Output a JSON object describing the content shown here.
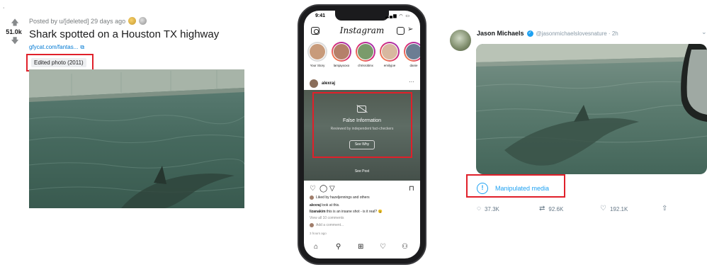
{
  "reddit": {
    "corner_mark": "˙",
    "score": "51.0k",
    "meta": "Posted by u/[deleted] 29 days ago",
    "title": "Shark spotted on a Houston TX highway",
    "link": "gfycat.com/fantas...",
    "flair": "Edited photo (2011)"
  },
  "instagram": {
    "time": "9:41",
    "status_icons": "▂▄▆ ◠ ▭",
    "logo": "Instagram",
    "stories": [
      {
        "name": "Your Story"
      },
      {
        "name": "lamjayxoxo"
      },
      {
        "name": "chrisrobinx"
      },
      {
        "name": "emilyjoe"
      },
      {
        "name": "danie"
      }
    ],
    "post_user": "alexraj",
    "more": "···",
    "overlay": {
      "title": "False Information",
      "subtitle": "Reviewed by independent fact-checkers",
      "button": "See Why",
      "see_post": "See Post"
    },
    "likes": "Liked by hazeljennings and others",
    "caption_user": "alexraj",
    "caption": "look at this.",
    "comment_user": "lizanakim",
    "comment": "this is an insane shot - is it real? 😮",
    "view_all": "View all 10 comments",
    "add_comment": "Add a comment...",
    "time_ago": "3 hours ago"
  },
  "twitter": {
    "name": "Jason Michaels",
    "handle": "@jasonmichaelslovesnature · 2h",
    "label": "Manipulated media",
    "replies": "37.3K",
    "retweets": "92.6K",
    "likes": "192.1K"
  },
  "colors": {
    "highlight": "#e0202a",
    "twitter_blue": "#1da1f2",
    "reddit_link": "#0079d3"
  }
}
